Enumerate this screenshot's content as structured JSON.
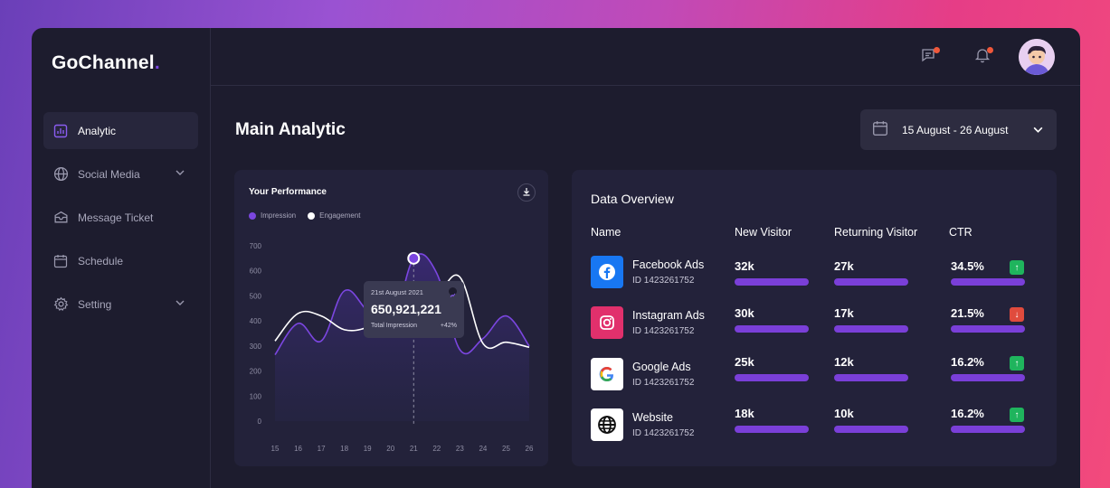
{
  "app": {
    "brand": "GoChannel",
    "brand_dot": "."
  },
  "sidebar": {
    "items": [
      {
        "label": "Analytic",
        "icon": "chart-icon",
        "active": true
      },
      {
        "label": "Social Media",
        "icon": "globe-icon",
        "has_submenu": true
      },
      {
        "label": "Message Ticket",
        "icon": "inbox-icon"
      },
      {
        "label": "Schedule",
        "icon": "calendar-icon"
      },
      {
        "label": "Setting",
        "icon": "gear-icon",
        "has_submenu": true
      }
    ]
  },
  "topbar": {
    "icons": [
      "message-icon",
      "bell-icon"
    ],
    "badge_color": "#f0573a"
  },
  "main": {
    "title": "Main Analytic",
    "date_range": "15 August - 26 August"
  },
  "performance": {
    "title": "Your Performance",
    "legend": [
      {
        "label": "Impression",
        "color": "#7b46e0"
      },
      {
        "label": "Engagement",
        "color": "#ffffff"
      }
    ],
    "tooltip": {
      "date": "21st August 2021",
      "value": "650,921,221",
      "label": "Total Impression",
      "change": "+42%"
    }
  },
  "chart_data": {
    "type": "line",
    "x": [
      "15",
      "16",
      "17",
      "18",
      "19",
      "20",
      "21",
      "22",
      "23",
      "24",
      "25",
      "26"
    ],
    "y_ticks": [
      "700",
      "600",
      "500",
      "400",
      "300",
      "200",
      "100",
      "0"
    ],
    "ylim": [
      0,
      700
    ],
    "series": [
      {
        "name": "Impression",
        "values": [
          265,
          390,
          320,
          520,
          440,
          360,
          650,
          590,
          285,
          330,
          420,
          300
        ]
      },
      {
        "name": "Engagement",
        "values": [
          320,
          430,
          420,
          365,
          375,
          430,
          520,
          510,
          575,
          310,
          315,
          295
        ]
      }
    ],
    "highlight_index": 6
  },
  "overview": {
    "title": "Data Overview",
    "headers": [
      "Name",
      "New Visitor",
      "Returning Visitor",
      "CTR"
    ],
    "rows": [
      {
        "name": "Facebook Ads",
        "id": "ID 1423261752",
        "new": "32k",
        "returning": "27k",
        "ctr": "34.5%",
        "trend": "up",
        "logo": "facebook-icon",
        "logo_color": "#1877f2"
      },
      {
        "name": "Instagram Ads",
        "id": "ID 1423261752",
        "new": "30k",
        "returning": "17k",
        "ctr": "21.5%",
        "trend": "down",
        "logo": "instagram-icon",
        "logo_color": "#e1306c"
      },
      {
        "name": "Google Ads",
        "id": "ID 1423261752",
        "new": "25k",
        "returning": "12k",
        "ctr": "16.2%",
        "trend": "up",
        "logo": "google-icon",
        "logo_color": "#ffffff"
      },
      {
        "name": "Website",
        "id": "ID 1423261752",
        "new": "18k",
        "returning": "10k",
        "ctr": "16.2%",
        "trend": "up",
        "logo": "globe-icon",
        "logo_color": "#ffffff"
      }
    ],
    "trend_colors": {
      "up": "#1fb45d",
      "down": "#e04b3d"
    },
    "bar_color": "#7a3fd8"
  }
}
